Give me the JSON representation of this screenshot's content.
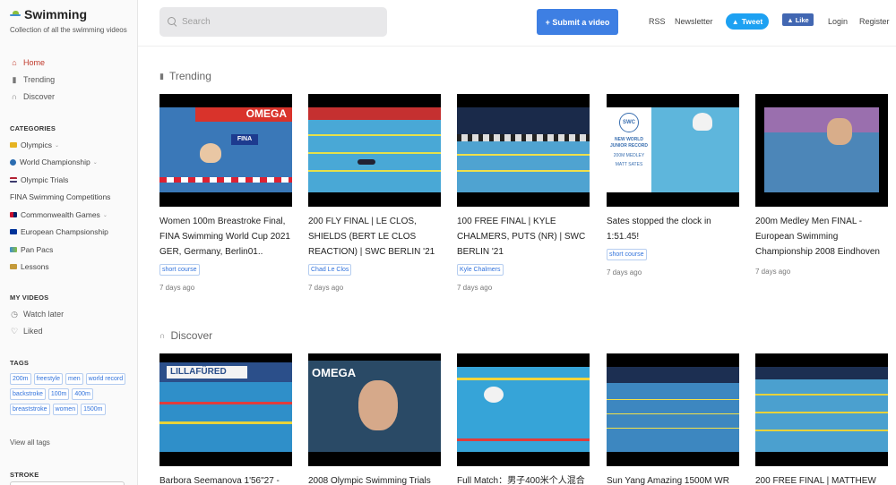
{
  "brand": {
    "title": "Swimming",
    "subtitle": "Collection of all the swimming videos"
  },
  "nav": [
    {
      "label": "Home",
      "icon": "home-icon"
    },
    {
      "label": "Trending",
      "icon": "trending-icon"
    },
    {
      "label": "Discover",
      "icon": "headphones-icon"
    }
  ],
  "categories_title": "CATEGORIES",
  "categories": [
    {
      "label": "Olympics",
      "has_menu": true
    },
    {
      "label": "World Championship",
      "has_menu": true
    },
    {
      "label": "Olympic Trials",
      "has_menu": false
    },
    {
      "label": "FINA Swimming Competitions",
      "has_menu": false
    },
    {
      "label": "Commonwealth Games",
      "has_menu": true
    },
    {
      "label": "European Champsionship",
      "has_menu": false
    },
    {
      "label": "Pan Pacs",
      "has_menu": false
    },
    {
      "label": "Lessons",
      "has_menu": false
    }
  ],
  "myvideos_title": "MY VIDEOS",
  "myvideos": [
    {
      "label": "Watch later",
      "icon": "clock-icon"
    },
    {
      "label": "Liked",
      "icon": "thumbs-up-icon"
    }
  ],
  "tags_title": "TAGS",
  "tags": [
    "200m",
    "freestyle",
    "men",
    "world record",
    "backstroke",
    "100m",
    "400m",
    "breaststroke",
    "women",
    "1500m"
  ],
  "view_all_tags": "View all tags",
  "stroke_title": "STROKE",
  "header": {
    "search_placeholder": "Search",
    "submit_label": "+ Submit a video",
    "rss": "RSS",
    "newsletter": "Newsletter",
    "tweet": "Tweet",
    "like": "Like",
    "login": "Login",
    "register": "Register"
  },
  "trending": {
    "title": "Trending",
    "videos": [
      {
        "title": "Women 100m Breastroke Final, FINA Swimming World Cup 2021 GER, Germany, Berlin01..",
        "tag": "short course",
        "date": "7 days ago"
      },
      {
        "title": "200 FLY FINAL | LE CLOS, SHIELDS (BERT LE CLOS REACTION) | SWC BERLIN '21",
        "tag": "Chad Le Clos",
        "date": "7 days ago"
      },
      {
        "title": "100 FREE FINAL | KYLE CHALMERS, PUTS (NR) | SWC BERLIN '21",
        "tag": "Kyle Chalmers",
        "date": "7 days ago"
      },
      {
        "title": "Sates stopped the clock in 1:51.45!",
        "tag": "short course",
        "date": "7 days ago"
      },
      {
        "title": "200m Medley Men FINAL - European Swimming Championship 2008 Eindhoven",
        "tag": "",
        "date": "7 days ago"
      }
    ]
  },
  "discover": {
    "title": "Discover",
    "videos": [
      {
        "title": "Barbora Seemanova 1'56\"27 -"
      },
      {
        "title": "2008 Olympic Swimming Trials"
      },
      {
        "title": "Full Match：男子400米个人混合泳"
      },
      {
        "title": "Sun Yang Amazing 1500M WR"
      },
      {
        "title": "200 FREE FINAL | MATTHEW"
      }
    ]
  },
  "thumb_text": {
    "omega": "OMEGA",
    "fina": "FINA",
    "lillafured": "LILLAFÜRED",
    "swc": "SWC",
    "record": "NEW WORLD JUNIOR RECORD",
    "medley": "200M MEDLEY",
    "name": "MATT SATES"
  }
}
